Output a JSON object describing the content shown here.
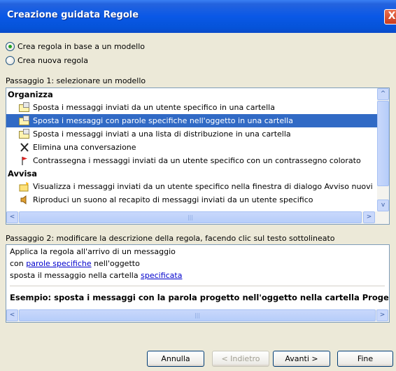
{
  "window": {
    "title": "Creazione guidata Regole",
    "close_glyph": "X"
  },
  "options": [
    {
      "label": "Crea regola in base a un modello",
      "checked": true
    },
    {
      "label": "Crea nuova regola",
      "checked": false
    }
  ],
  "step1": {
    "label": "Passaggio 1: selezionare un modello",
    "groups": [
      {
        "title": "Organizza",
        "items": [
          {
            "label": "Sposta i messaggi inviati da un utente specifico in una cartella",
            "icon": "move-folder-icon",
            "selected": false
          },
          {
            "label": "Sposta i messaggi con parole specifiche nell'oggetto in una cartella",
            "icon": "move-folder-icon",
            "selected": true
          },
          {
            "label": "Sposta i messaggi inviati a una lista di distribuzione in una cartella",
            "icon": "move-folder-icon",
            "selected": false
          },
          {
            "label": "Elimina una conversazione",
            "icon": "delete-x-icon",
            "selected": false
          },
          {
            "label": "Contrassegna i messaggi inviati da un utente specifico con un contrassegno colorato",
            "icon": "red-flag-icon",
            "selected": false
          }
        ]
      },
      {
        "title": "Avvisa",
        "items": [
          {
            "label": "Visualizza i messaggi inviati da un utente specifico nella finestra di dialogo Avviso nuovi",
            "icon": "alert-envelope-icon",
            "selected": false
          },
          {
            "label": "Riproduci un suono al recapito di messaggi inviati da un utente specifico",
            "icon": "sound-speaker-icon",
            "selected": false
          }
        ]
      }
    ],
    "scroll_up": "^",
    "scroll_down": "v",
    "scroll_left": "<",
    "scroll_right": ">",
    "grip": "|||"
  },
  "step2": {
    "label": "Passaggio 2: modificare la descrizione della regola, facendo clic sul testo sottolineato",
    "line1": "Applica la regola all'arrivo di un messaggio",
    "line2_prefix": "con ",
    "line2_link": "parole specifiche",
    "line2_suffix": " nell'oggetto",
    "line3_prefix": "sposta il messaggio nella cartella ",
    "line3_link": "specificata",
    "example": "Esempio: sposta i messaggi con la parola progetto nell'oggetto nella cartella Proge"
  },
  "buttons": {
    "cancel": "Annulla",
    "back": "< Indietro",
    "next": "Avanti >",
    "finish": "Fine"
  },
  "colors": {
    "selection": "#316ac5",
    "link": "#0000cc",
    "titlebar": "#0a58e6"
  }
}
